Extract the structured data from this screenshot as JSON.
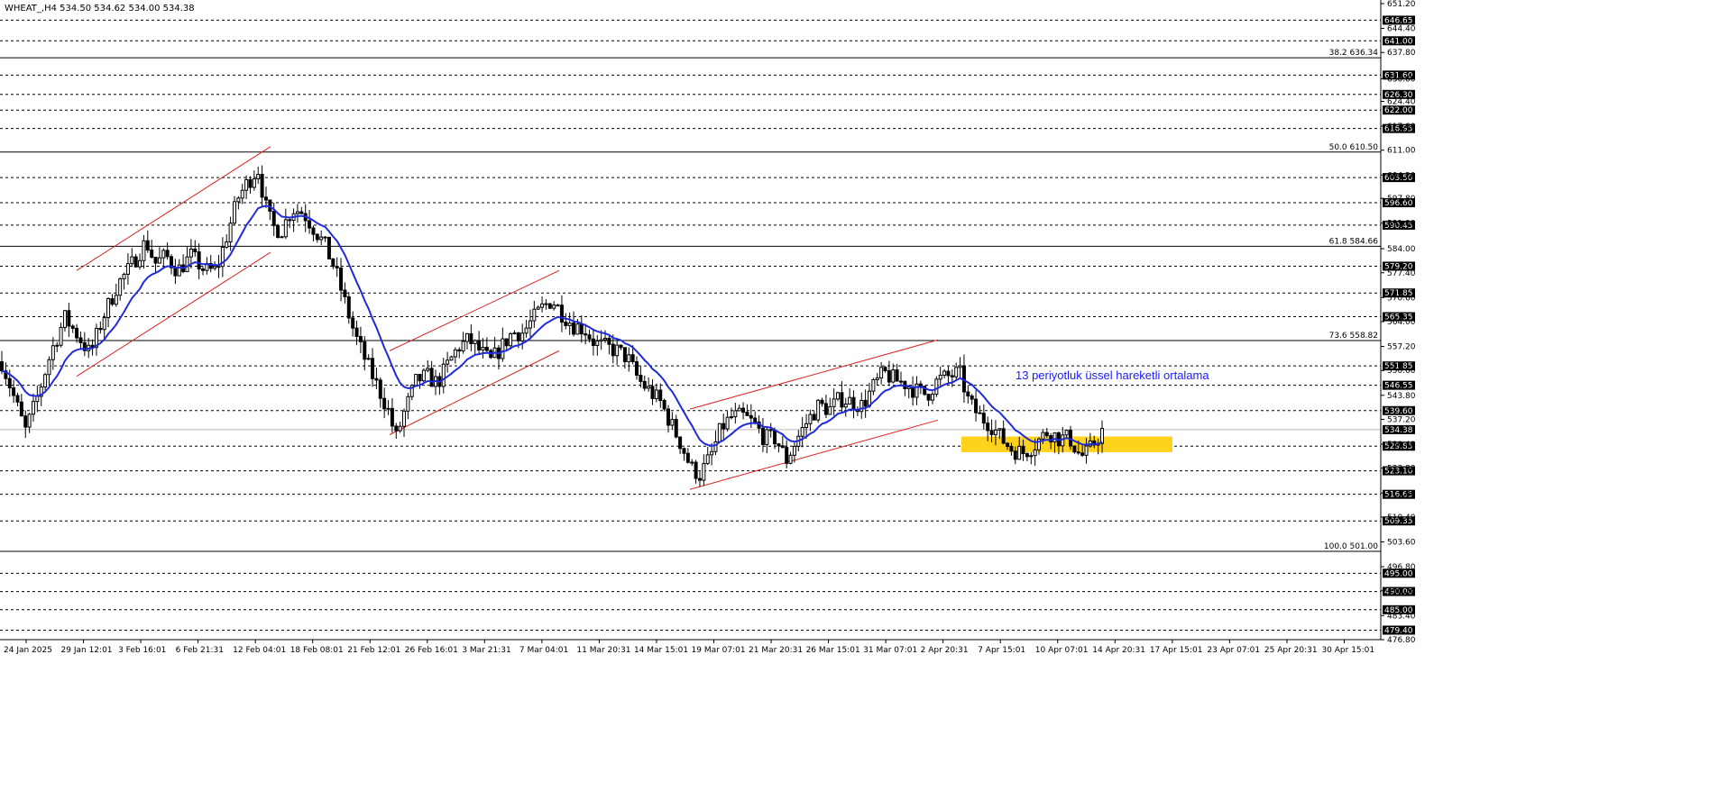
{
  "window": {
    "title": "WHEAT_,H4  534.50 534.62 534.00 534.38"
  },
  "colors": {
    "background": "#ffffff",
    "candle": "#000000",
    "ema": "#1f2bdc",
    "channel": "#dd2222",
    "highlight": "#ffd21e",
    "annotation": "#1a1aff",
    "level_tag_bg": "#000000",
    "level_tag_text": "#ffffff"
  },
  "chart_data": {
    "type": "candlestick",
    "symbol": "WHEAT_",
    "timeframe": "H4",
    "ylim": [
      476.8,
      651.2
    ],
    "y_ticks": [
      651.2,
      644.4,
      637.8,
      630.6,
      624.4,
      617.6,
      611.0,
      604.2,
      597.8,
      591.0,
      584.0,
      577.4,
      570.6,
      564.0,
      557.2,
      550.6,
      543.8,
      537.2,
      530.4,
      523.8,
      517.0,
      510.4,
      503.6,
      496.8,
      490.2,
      483.4,
      476.8
    ],
    "x_labels": [
      "24 Jan 2025",
      "29 Jan 12:01",
      "3 Feb 16:01",
      "6 Feb 21:31",
      "12 Feb 04:01",
      "18 Feb 08:01",
      "21 Feb 12:01",
      "26 Feb 16:01",
      "3 Mar 21:31",
      "7 Mar 04:01",
      "11 Mar 20:31",
      "14 Mar 15:01",
      "19 Mar 07:01",
      "21 Mar 20:31",
      "26 Mar 15:01",
      "31 Mar 07:01",
      "2 Apr 20:31",
      "7 Apr 15:01",
      "10 Apr 07:01",
      "14 Apr 20:31",
      "17 Apr 15:01",
      "23 Apr 07:01",
      "25 Apr 20:31",
      "30 Apr 15:01"
    ],
    "current_price": "534.38",
    "horizontal_levels": [
      "646.65",
      "641.00",
      "631.60",
      "626.30",
      "622.00",
      "616.95",
      "603.50",
      "596.60",
      "590.45",
      "579.20",
      "571.85",
      "565.35",
      "551.85",
      "546.55",
      "539.60",
      "529.85",
      "523.10",
      "516.65",
      "509.35",
      "495.00",
      "490.00",
      "485.00",
      "479.40"
    ],
    "fibonacci_levels": [
      {
        "label": "38.2 636.34",
        "price": 636.34
      },
      {
        "label": "50.0 610.50",
        "price": 610.5
      },
      {
        "label": "61.8 584.66",
        "price": 584.66
      },
      {
        "label": "73.6 558.82",
        "price": 558.82
      },
      {
        "label": "100.0 501.00",
        "price": 501.0
      }
    ],
    "ema": {
      "name": "13 periyotluk üssel hareketli ortalama",
      "period": 13
    },
    "annotation": "13 periyotluk üssel hareketli ortalama",
    "price_path": [
      [
        0,
        553
      ],
      [
        18,
        540
      ],
      [
        26,
        534
      ],
      [
        38,
        542
      ],
      [
        55,
        556
      ],
      [
        70,
        565
      ],
      [
        85,
        560
      ],
      [
        98,
        555
      ],
      [
        112,
        565
      ],
      [
        128,
        574
      ],
      [
        140,
        578
      ],
      [
        150,
        582
      ],
      [
        160,
        586
      ],
      [
        170,
        580
      ],
      [
        182,
        582
      ],
      [
        195,
        578
      ],
      [
        210,
        582
      ],
      [
        225,
        578
      ],
      [
        238,
        578
      ],
      [
        250,
        588
      ],
      [
        262,
        598
      ],
      [
        272,
        602
      ],
      [
        284,
        606
      ],
      [
        292,
        596
      ],
      [
        300,
        590
      ],
      [
        310,
        589
      ],
      [
        322,
        595
      ],
      [
        334,
        594
      ],
      [
        345,
        590
      ],
      [
        358,
        585
      ],
      [
        370,
        578
      ],
      [
        382,
        568
      ],
      [
        392,
        560
      ],
      [
        404,
        553
      ],
      [
        415,
        547
      ],
      [
        428,
        540
      ],
      [
        437,
        532
      ],
      [
        446,
        539
      ],
      [
        460,
        548
      ],
      [
        472,
        549
      ],
      [
        483,
        547
      ],
      [
        494,
        552
      ],
      [
        506,
        557
      ],
      [
        518,
        559
      ],
      [
        530,
        556
      ],
      [
        542,
        553
      ],
      [
        554,
        557
      ],
      [
        566,
        561
      ],
      [
        578,
        561
      ],
      [
        590,
        565
      ],
      [
        600,
        568
      ],
      [
        610,
        570
      ],
      [
        622,
        566
      ],
      [
        634,
        563
      ],
      [
        646,
        562
      ],
      [
        658,
        558
      ],
      [
        670,
        557
      ],
      [
        682,
        556
      ],
      [
        694,
        554
      ],
      [
        706,
        548
      ],
      [
        718,
        545
      ],
      [
        730,
        542
      ],
      [
        742,
        536
      ],
      [
        754,
        530
      ],
      [
        764,
        524
      ],
      [
        774,
        522
      ],
      [
        786,
        527
      ],
      [
        798,
        535
      ],
      [
        810,
        538
      ],
      [
        822,
        538
      ],
      [
        834,
        536
      ],
      [
        846,
        532
      ],
      [
        858,
        532
      ],
      [
        870,
        526
      ],
      [
        882,
        532
      ],
      [
        894,
        537
      ],
      [
        906,
        541
      ],
      [
        918,
        540
      ],
      [
        930,
        543
      ],
      [
        942,
        542
      ],
      [
        954,
        541
      ],
      [
        966,
        546
      ],
      [
        978,
        550
      ],
      [
        990,
        548
      ],
      [
        1002,
        547
      ],
      [
        1014,
        545
      ],
      [
        1026,
        544
      ],
      [
        1038,
        548
      ],
      [
        1050,
        549
      ],
      [
        1062,
        550
      ],
      [
        1072,
        542
      ],
      [
        1084,
        538
      ],
      [
        1096,
        536
      ],
      [
        1108,
        532
      ],
      [
        1120,
        529
      ],
      [
        1132,
        528
      ],
      [
        1144,
        530
      ],
      [
        1160,
        534
      ],
      [
        1172,
        532
      ],
      [
        1184,
        532
      ],
      [
        1196,
        527
      ],
      [
        1204,
        528
      ],
      [
        1212,
        531
      ],
      [
        1220,
        534
      ]
    ]
  }
}
